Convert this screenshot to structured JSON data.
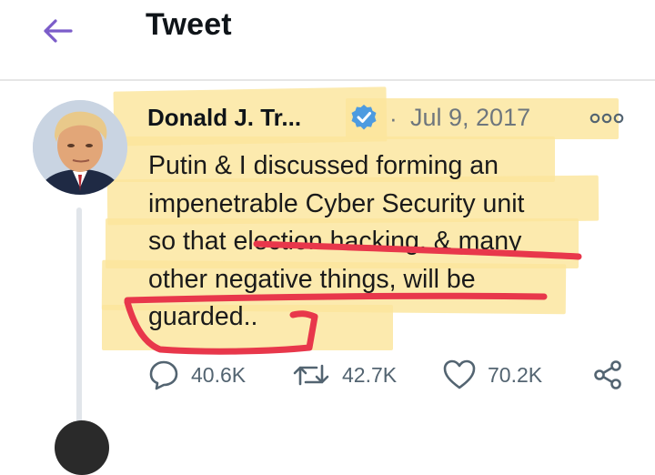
{
  "header": {
    "title": "Tweet",
    "back_icon": "arrow-left-icon",
    "accent": "#7b5cc9"
  },
  "tweet": {
    "author_name": "Donald J. Tr...",
    "verified": true,
    "separator": "·",
    "date": "Jul 9, 2017",
    "text_lines": [
      "Putin & I discussed forming an",
      "impenetrable Cyber Security unit",
      "so that election hacking, & many",
      "other negative things, will be",
      "guarded.."
    ]
  },
  "actions": {
    "replies": "40.6K",
    "retweets": "42.7K",
    "likes": "70.2K"
  },
  "colors": {
    "highlight": "#fbe59c",
    "red_marker": "#e8374b",
    "verified_blue": "#4d9be0",
    "muted_text": "#6e767d"
  }
}
